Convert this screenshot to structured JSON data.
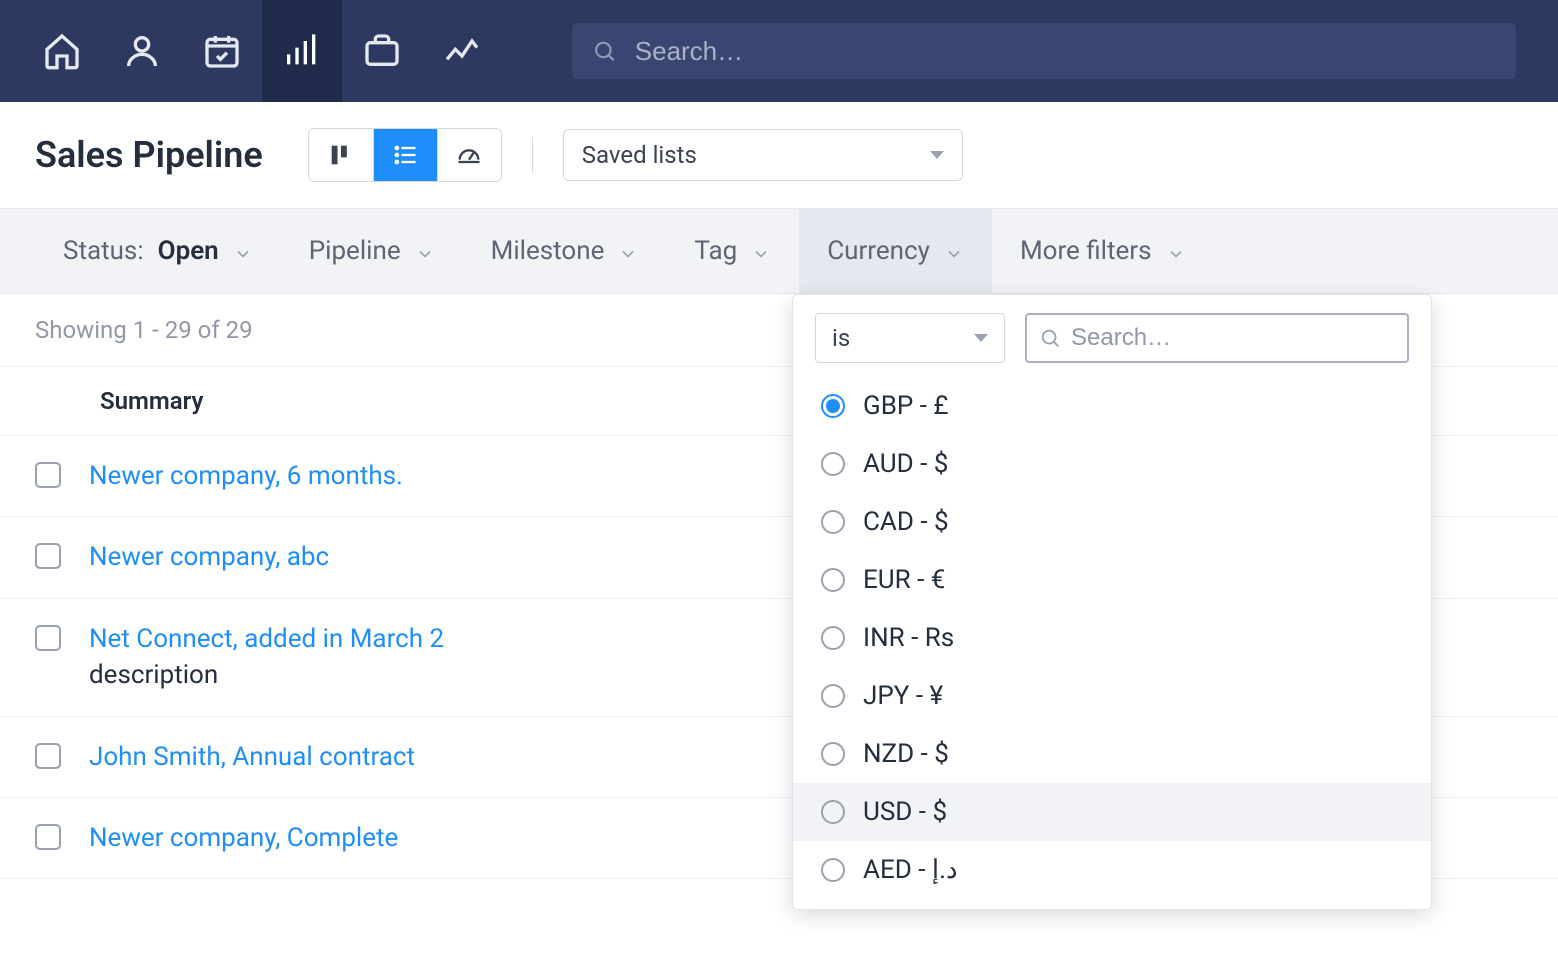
{
  "search": {
    "placeholder": "Search…"
  },
  "page": {
    "title": "Sales Pipeline"
  },
  "saved_lists": {
    "label": "Saved lists"
  },
  "filters": {
    "status_label": "Status:",
    "status_value": "Open",
    "pipeline": "Pipeline",
    "milestone": "Milestone",
    "tag": "Tag",
    "currency": "Currency",
    "more": "More filters"
  },
  "showing": "Showing 1 - 29 of 29",
  "columns": {
    "summary": "Summary"
  },
  "rows": [
    {
      "title": "Newer company, 6 months.",
      "desc": ""
    },
    {
      "title": "Newer company, abc",
      "desc": ""
    },
    {
      "title": "Net Connect, added in March 2",
      "desc": "description"
    },
    {
      "title": "John Smith, Annual contract",
      "desc": ""
    },
    {
      "title": "Newer company, Complete",
      "desc": ""
    }
  ],
  "currency_popup": {
    "operator": "is",
    "search_placeholder": "Search…",
    "options": [
      {
        "label": "GBP - £",
        "selected": true
      },
      {
        "label": "AUD - $",
        "selected": false
      },
      {
        "label": "CAD - $",
        "selected": false
      },
      {
        "label": "EUR - €",
        "selected": false
      },
      {
        "label": "INR - Rs",
        "selected": false
      },
      {
        "label": "JPY - ¥",
        "selected": false
      },
      {
        "label": "NZD - $",
        "selected": false
      },
      {
        "label": "USD - $",
        "selected": false,
        "hover": true
      },
      {
        "label": "AED - د.إ",
        "selected": false
      }
    ]
  }
}
